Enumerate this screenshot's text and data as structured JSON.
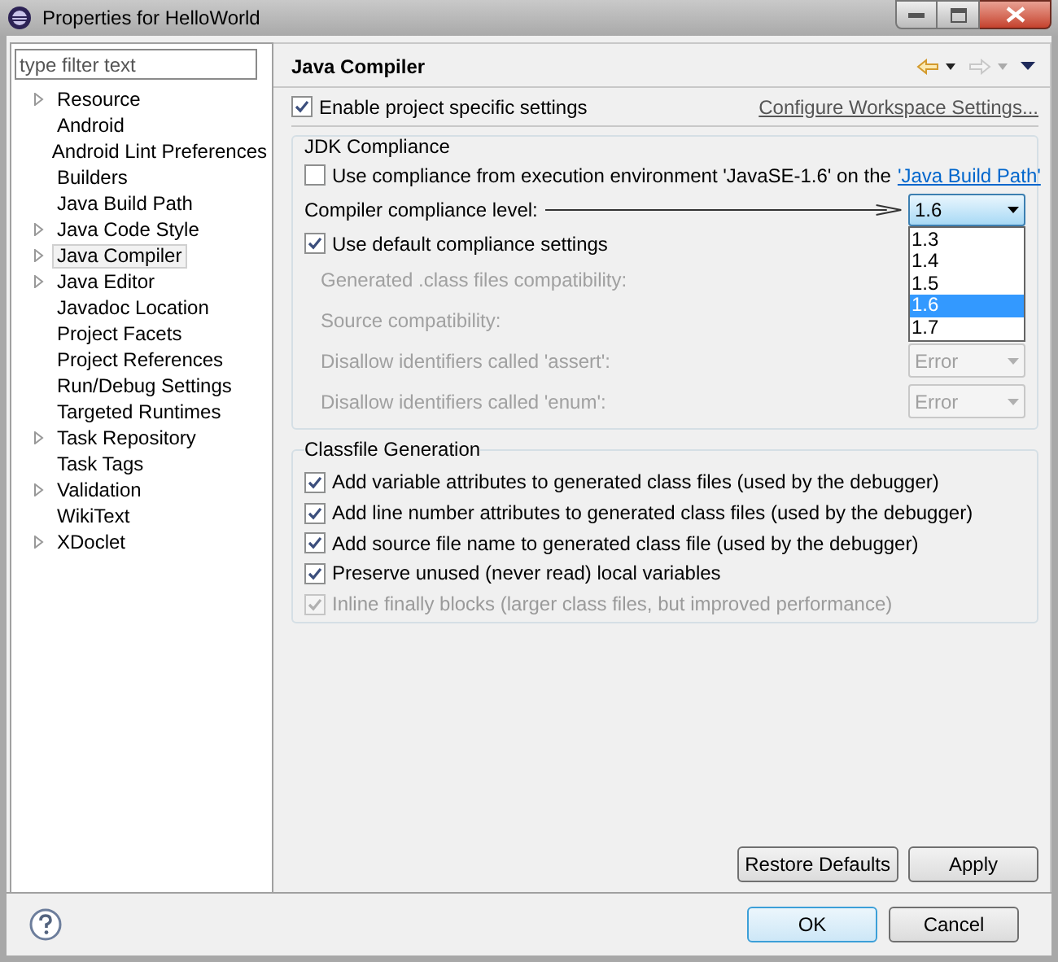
{
  "window": {
    "title": "Properties for HelloWorld"
  },
  "filter": {
    "placeholder": "type filter text"
  },
  "tree": [
    {
      "label": "Resource",
      "expandable": true,
      "selected": false
    },
    {
      "label": "Android",
      "expandable": false,
      "selected": false
    },
    {
      "label": "Android Lint Preferences",
      "expandable": false,
      "selected": false
    },
    {
      "label": "Builders",
      "expandable": false,
      "selected": false
    },
    {
      "label": "Java Build Path",
      "expandable": false,
      "selected": false
    },
    {
      "label": "Java Code Style",
      "expandable": true,
      "selected": false
    },
    {
      "label": "Java Compiler",
      "expandable": true,
      "selected": true
    },
    {
      "label": "Java Editor",
      "expandable": true,
      "selected": false
    },
    {
      "label": "Javadoc Location",
      "expandable": false,
      "selected": false
    },
    {
      "label": "Project Facets",
      "expandable": false,
      "selected": false
    },
    {
      "label": "Project References",
      "expandable": false,
      "selected": false
    },
    {
      "label": "Run/Debug Settings",
      "expandable": false,
      "selected": false
    },
    {
      "label": "Targeted Runtimes",
      "expandable": false,
      "selected": false
    },
    {
      "label": "Task Repository",
      "expandable": true,
      "selected": false
    },
    {
      "label": "Task Tags",
      "expandable": false,
      "selected": false
    },
    {
      "label": "Validation",
      "expandable": true,
      "selected": false
    },
    {
      "label": "WikiText",
      "expandable": false,
      "selected": false
    },
    {
      "label": "XDoclet",
      "expandable": true,
      "selected": false
    }
  ],
  "page": {
    "title": "Java Compiler"
  },
  "enable_project_settings": {
    "label": "Enable project specific settings",
    "checked": true
  },
  "configure_link": "Configure Workspace Settings...",
  "jdk_compliance": {
    "title": "JDK Compliance",
    "use_execution_environment": {
      "label": "Use compliance from execution environment 'JavaSE-1.6' on the",
      "link": "'Java Build Path'",
      "checked": false
    },
    "compliance_level": {
      "label": "Compiler compliance level:",
      "value": "1.6",
      "options": [
        {
          "label": "1.3",
          "selected": false
        },
        {
          "label": "1.4",
          "selected": false
        },
        {
          "label": "1.5",
          "selected": false
        },
        {
          "label": "1.6",
          "selected": true
        },
        {
          "label": "1.7",
          "selected": false
        }
      ]
    },
    "use_default": {
      "label": "Use default compliance settings",
      "checked": true
    },
    "settings": [
      {
        "label": "Generated .class files compatibility:",
        "disabled": true
      },
      {
        "label": "Source compatibility:",
        "disabled": true
      },
      {
        "label": "Disallow identifiers called 'assert':",
        "value": "Error",
        "disabled": true
      },
      {
        "label": "Disallow identifiers called 'enum':",
        "value": "Error",
        "disabled": true
      }
    ]
  },
  "classfile_generation": {
    "title": "Classfile Generation",
    "options": [
      {
        "label": "Add variable attributes to generated class files (used by the debugger)",
        "checked": true,
        "disabled": false
      },
      {
        "label": "Add line number attributes to generated class files (used by the debugger)",
        "checked": true,
        "disabled": false
      },
      {
        "label": "Add source file name to generated class file (used by the debugger)",
        "checked": true,
        "disabled": false
      },
      {
        "label": "Preserve unused (never read) local variables",
        "checked": true,
        "disabled": false
      },
      {
        "label": "Inline finally blocks (larger class files, but improved performance)",
        "checked": true,
        "disabled": true
      }
    ]
  },
  "page_buttons": [
    "Restore Defaults",
    "Apply"
  ],
  "dialog_buttons": [
    {
      "label": "OK",
      "kind": "default"
    },
    {
      "label": "Cancel",
      "kind": "normal"
    }
  ]
}
